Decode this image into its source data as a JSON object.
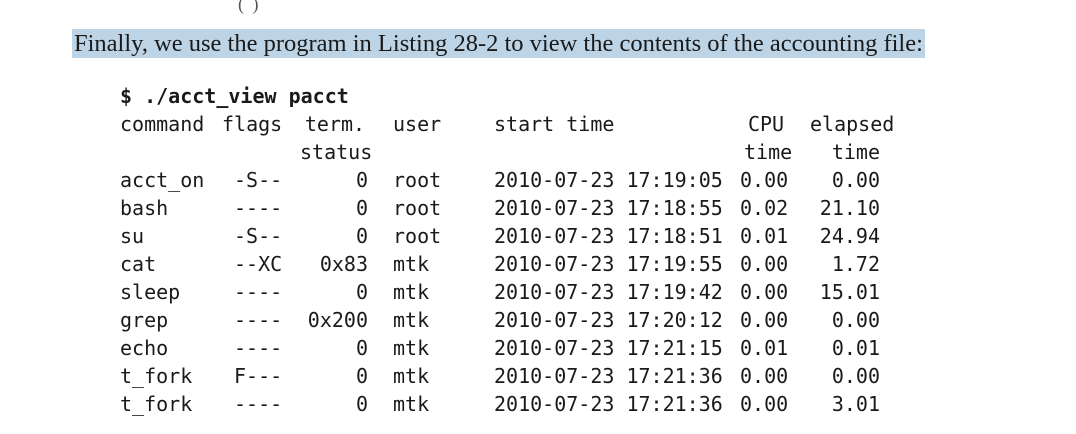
{
  "page": {
    "top_fragment": "( )",
    "intro_text": "Finally, we use the program in Listing 28-2 to view the contents of the accounting file:",
    "highlight_color": "#bcd4e6"
  },
  "listing": {
    "prompt": "$",
    "command": "./acct_view pacct",
    "headers": {
      "command": "command",
      "flags": "flags",
      "term_line1": "term.",
      "term_line2": "status",
      "user": "user",
      "start_time": "start time",
      "cpu_line1": "CPU",
      "cpu_line2": "time",
      "elapsed_line1": "elapsed",
      "elapsed_line2": "time"
    },
    "rows": [
      {
        "command": "acct_on",
        "flags": "-S--",
        "term": "0",
        "user": "root",
        "start": "2010-07-23 17:19:05",
        "cpu": "0.00",
        "elapsed": "0.00"
      },
      {
        "command": "bash",
        "flags": "----",
        "term": "0",
        "user": "root",
        "start": "2010-07-23 17:18:55",
        "cpu": "0.02",
        "elapsed": "21.10"
      },
      {
        "command": "su",
        "flags": "-S--",
        "term": "0",
        "user": "root",
        "start": "2010-07-23 17:18:51",
        "cpu": "0.01",
        "elapsed": "24.94"
      },
      {
        "command": "cat",
        "flags": "--XC",
        "term": "0x83",
        "user": "mtk",
        "start": "2010-07-23 17:19:55",
        "cpu": "0.00",
        "elapsed": "1.72"
      },
      {
        "command": "sleep",
        "flags": "----",
        "term": "0",
        "user": "mtk",
        "start": "2010-07-23 17:19:42",
        "cpu": "0.00",
        "elapsed": "15.01"
      },
      {
        "command": "grep",
        "flags": "----",
        "term": "0x200",
        "user": "mtk",
        "start": "2010-07-23 17:20:12",
        "cpu": "0.00",
        "elapsed": "0.00"
      },
      {
        "command": "echo",
        "flags": "----",
        "term": "0",
        "user": "mtk",
        "start": "2010-07-23 17:21:15",
        "cpu": "0.01",
        "elapsed": "0.01"
      },
      {
        "command": "t_fork",
        "flags": "F---",
        "term": "0",
        "user": "mtk",
        "start": "2010-07-23 17:21:36",
        "cpu": "0.00",
        "elapsed": "0.00"
      },
      {
        "command": "t_fork",
        "flags": "----",
        "term": "0",
        "user": "mtk",
        "start": "2010-07-23 17:21:36",
        "cpu": "0.00",
        "elapsed": "3.01"
      }
    ]
  }
}
